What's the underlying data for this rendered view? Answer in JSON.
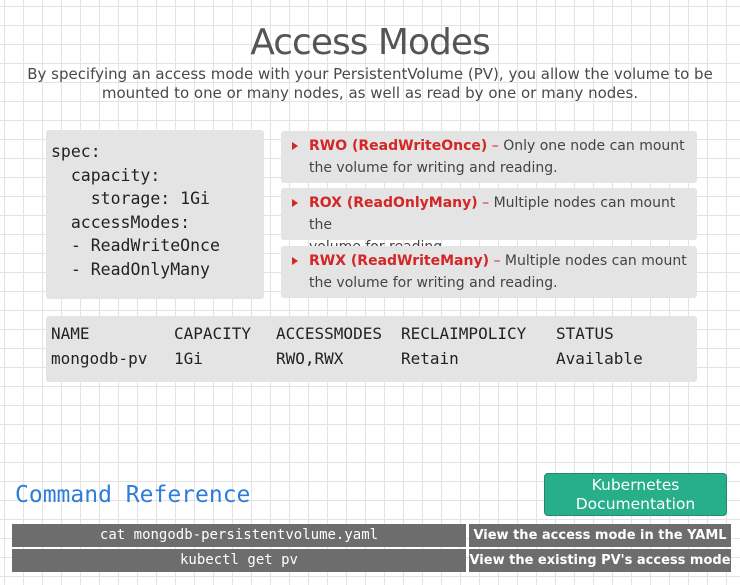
{
  "title": "Access Modes",
  "subtitle": {
    "line1": "By specifying an access mode with your PersistentVolume (PV), you allow the volume to be",
    "line2": "mounted to one or many nodes, as well as read by one or many nodes."
  },
  "spec_code": [
    "spec:",
    "  capacity:",
    "    storage: 1Gi",
    "  accessModes:",
    "  - ReadWriteOnce",
    "  - ReadOnlyMany"
  ],
  "access_modes": [
    {
      "name": "RWO (ReadWriteOnce)",
      "separator": " – ",
      "desc_line1": "Only one node can mount",
      "desc_line2": "the volume for writing and reading."
    },
    {
      "name": "ROX (ReadOnlyMany)",
      "separator": " – ",
      "desc_line1": "Multiple nodes can mount the",
      "desc_line2": "volume for reading."
    },
    {
      "name": "RWX (ReadWriteMany)",
      "separator": " – ",
      "desc_line1": "Multiple nodes can mount",
      "desc_line2": "the volume for writing and reading."
    }
  ],
  "pv_table": {
    "headers": [
      "NAME",
      "CAPACITY",
      "ACCESSMODES",
      "RECLAIMPOLICY",
      "STATUS"
    ],
    "row": [
      "mongodb-pv",
      "1Gi",
      "RWO,RWX",
      "Retain",
      "Available"
    ]
  },
  "command_reference": {
    "title": "Command Reference",
    "docs_button": {
      "line1": "Kubernetes",
      "line2": "Documentation"
    },
    "commands": [
      {
        "command": "cat mongodb-persistentvolume.yaml",
        "description": "View the access mode in the YAML"
      },
      {
        "command": "kubectl get pv",
        "description": "View the existing PV's access mode"
      }
    ]
  },
  "colors": {
    "accent_red": "#d32626",
    "command_title_blue": "#2e7dd6",
    "docs_button_green": "#27ae8a",
    "command_row_gray": "#6d6d6d",
    "panel_gray": "#e4e4e4"
  }
}
